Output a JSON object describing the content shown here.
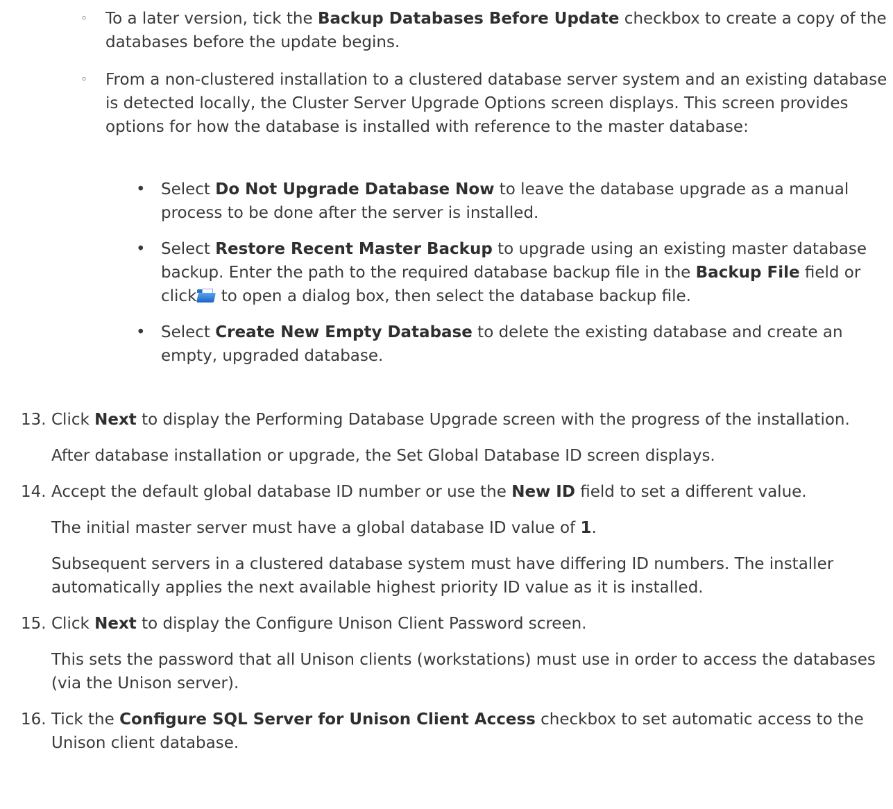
{
  "circle_items": [
    {
      "marker": "◦",
      "parts": [
        {
          "t": "To a later version, tick the ",
          "b": false
        },
        {
          "t": "Backup Databases Before Update",
          "b": true
        },
        {
          "t": " checkbox to create a copy of the databases before the update begins.",
          "b": false
        }
      ]
    },
    {
      "marker": "◦",
      "parts": [
        {
          "t": "From a non-clustered installation to a clustered database server system and an existing database is detected locally, the Cluster Server Upgrade Options screen displays. This screen provides options for how the database is installed with reference to the master database:",
          "b": false
        }
      ]
    }
  ],
  "dot_items": [
    {
      "marker": "•",
      "parts": [
        {
          "t": "Select ",
          "b": false
        },
        {
          "t": "Do Not Upgrade Database Now",
          "b": true
        },
        {
          "t": " to leave the database upgrade as a manual process to be done after the server is installed.",
          "b": false
        }
      ]
    },
    {
      "marker": "•",
      "parts": [
        {
          "t": "Select ",
          "b": false
        },
        {
          "t": "Restore Recent Master Backup",
          "b": true
        },
        {
          "t": " to upgrade using an existing master database backup. Enter the path to the required database backup file in the ",
          "b": false
        },
        {
          "t": "Backup File",
          "b": true
        },
        {
          "t": " field or click",
          "b": false
        },
        {
          "icon": "folder-open-icon"
        },
        {
          "t": " to open a dialog box, then select the database backup file.",
          "b": false
        }
      ]
    },
    {
      "marker": "•",
      "parts": [
        {
          "t": "Select ",
          "b": false
        },
        {
          "t": "Create New Empty Database",
          "b": true
        },
        {
          "t": " to delete the existing database and create an empty, upgraded database.",
          "b": false
        }
      ]
    }
  ],
  "steps": [
    {
      "num": "13.",
      "paragraphs": [
        [
          {
            "t": "Click ",
            "b": false
          },
          {
            "t": "Next",
            "b": true
          },
          {
            "t": " to display the Performing Database Upgrade screen with the progress of the installation.",
            "b": false
          }
        ],
        [
          {
            "t": "After database installation or upgrade, the Set Global Database ID screen displays.",
            "b": false
          }
        ]
      ]
    },
    {
      "num": "14.",
      "paragraphs": [
        [
          {
            "t": "Accept the default global database ID number or use the ",
            "b": false
          },
          {
            "t": "New ID",
            "b": true
          },
          {
            "t": " field to set a different value.",
            "b": false
          }
        ],
        [
          {
            "t": "The initial master server must have a global database ID value of ",
            "b": false
          },
          {
            "t": "1",
            "b": true
          },
          {
            "t": ".",
            "b": false
          }
        ],
        [
          {
            "t": "Subsequent servers in a clustered database system must have differing ID numbers. The installer automatically applies the next available highest priority ID value as it is installed.",
            "b": false
          }
        ]
      ]
    },
    {
      "num": "15.",
      "paragraphs": [
        [
          {
            "t": "Click ",
            "b": false
          },
          {
            "t": "Next",
            "b": true
          },
          {
            "t": " to display the Configure Unison Client Password screen.",
            "b": false
          }
        ],
        [
          {
            "t": "This sets the password that all Unison clients (workstations) must use in order to access the databases (via the Unison server).",
            "b": false
          }
        ]
      ]
    },
    {
      "num": "16.",
      "paragraphs": [
        [
          {
            "t": "Tick the ",
            "b": false
          },
          {
            "t": "Configure SQL Server for Unison Client Access",
            "b": true
          },
          {
            "t": " checkbox to set automatic access to the Unison client database.",
            "b": false
          }
        ]
      ]
    }
  ]
}
